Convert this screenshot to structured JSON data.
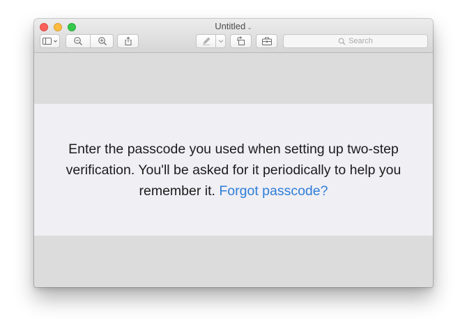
{
  "window": {
    "title": "Untitled",
    "title_chevron": "⌄"
  },
  "toolbar": {
    "sidebar_button": "sidebar-icon",
    "zoom_out_button": "zoom-out-icon",
    "zoom_in_button": "zoom-in-icon",
    "share_button": "share-icon",
    "markup_button": "pen-icon",
    "rotate_button": "rotate-icon",
    "toolbox_button": "toolbox-icon",
    "search": {
      "placeholder": "Search"
    }
  },
  "content": {
    "message": "Enter the passcode you used when setting up two-step verification. You'll be asked for it periodically to help you remember it.",
    "link": "Forgot passcode?"
  },
  "colors": {
    "band_background": "#efeff4",
    "link": "#2f7dd8",
    "window_background": "#dcdcdc"
  }
}
